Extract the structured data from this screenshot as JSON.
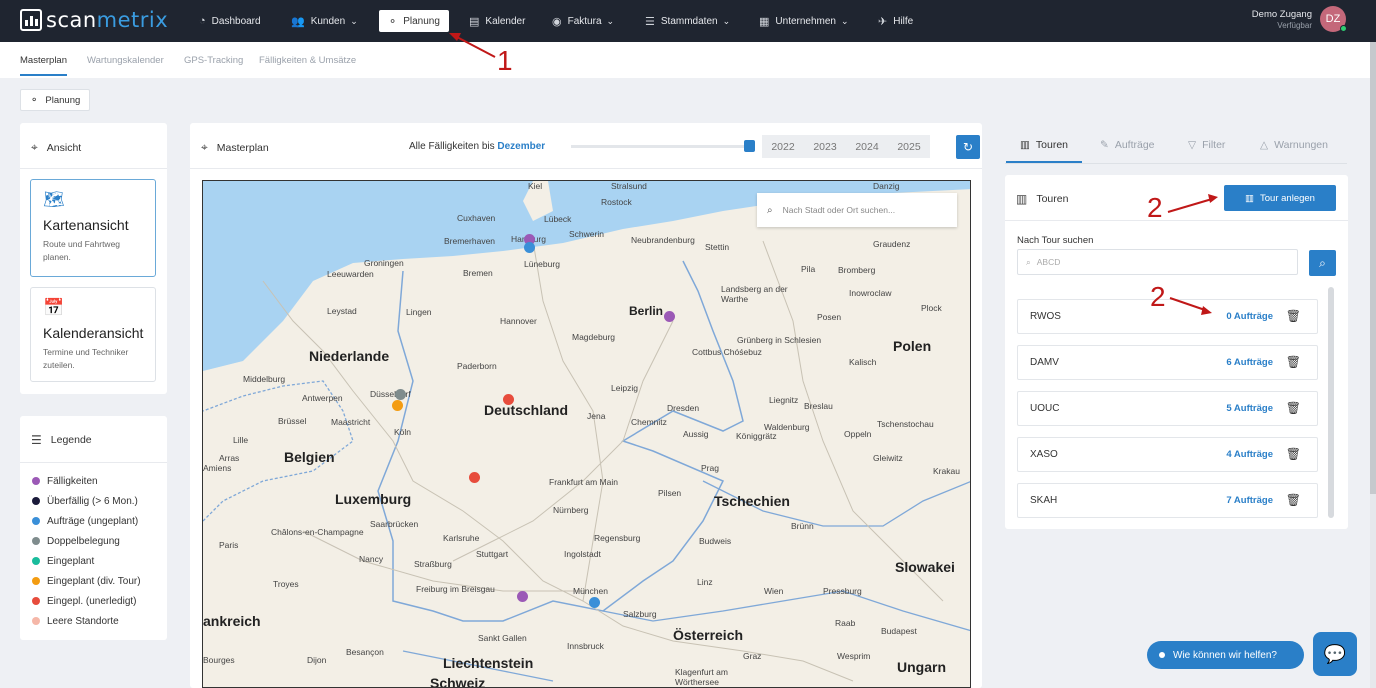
{
  "topnav": {
    "logo": {
      "part1": "scan",
      "part2": "metrix"
    },
    "items": [
      {
        "label": "Dashboard",
        "icon": "gauge-icon"
      },
      {
        "label": "Kunden",
        "icon": "users-icon"
      },
      {
        "label": "Planung",
        "icon": "hierarchy-icon"
      },
      {
        "label": "Kalender",
        "icon": "calendar-icon"
      },
      {
        "label": "Faktura",
        "icon": "coins-icon"
      },
      {
        "label": "Stammdaten",
        "icon": "database-icon"
      },
      {
        "label": "Unternehmen",
        "icon": "building-icon"
      },
      {
        "label": "Hilfe",
        "icon": "lifebuoy-icon"
      }
    ],
    "user": {
      "name": "Demo Zugang",
      "status": "Verfügbar",
      "initials": "DZ"
    }
  },
  "subnav": {
    "tabs": [
      "Masterplan",
      "Wartungskalender",
      "GPS-Tracking",
      "Fälligkeiten & Umsätze"
    ]
  },
  "chip": {
    "label": "Planung"
  },
  "ansicht": {
    "title": "Ansicht",
    "options": [
      {
        "title": "Kartenansicht",
        "desc": "Route und Fahrtweg planen."
      },
      {
        "title": "Kalenderansicht",
        "desc": "Termine und Techniker zuteilen."
      }
    ]
  },
  "legend": {
    "title": "Legende",
    "items": [
      {
        "label": "Fälligkeiten",
        "color": "#9b59b6"
      },
      {
        "label": "Überfällig (> 6 Mon.)",
        "color": "#1a1a3a"
      },
      {
        "label": "Aufträge (ungeplant)",
        "color": "#3a8fd8"
      },
      {
        "label": "Doppelbelegung",
        "color": "#7f8c8d"
      },
      {
        "label": "Eingeplant",
        "color": "#1abc9c"
      },
      {
        "label": "Eingeplant (div. Tour)",
        "color": "#f39c12"
      },
      {
        "label": "Eingepl. (unerledigt)",
        "color": "#e74c3c"
      },
      {
        "label": "Leere Standorte",
        "color": "#f5b7a8"
      }
    ]
  },
  "masterplan": {
    "title": "Masterplan",
    "due_label": "Alle Fälligkeiten bis",
    "due_month": "Dezember",
    "years": [
      "2022",
      "2023",
      "2024",
      "2025"
    ],
    "selected_year": "2022",
    "slider_level": 1.0,
    "map_search_placeholder": "Nach Stadt oder Ort suchen...",
    "map_labels": {
      "countries": [
        "Niederlande",
        "Deutschland",
        "Polen",
        "Belgien",
        "Tschechien",
        "Slowakei",
        "Österreich",
        "Ungarn",
        "ankreich",
        "Schweiz",
        "Liechtenstein",
        "Luxemburg"
      ],
      "cities": [
        "Kiel",
        "Stralsund",
        "Danzig",
        "Rostock",
        "Cuxhaven",
        "Lübeck",
        "Bremerhaven",
        "Hamburg",
        "Schwerin",
        "Neubrandenburg",
        "Stettin",
        "Graudenz",
        "Groningen",
        "Bremen",
        "Lüneburg",
        "Pila",
        "Bromberg",
        "Inowroclaw",
        "Leeuwarden",
        "Leystad",
        "Lingen",
        "Hannover",
        "Berlin",
        "Landsberg an der Warthe",
        "Posen",
        "Plock",
        "Magdeburg",
        "Cottbus Chóśebuz",
        "Grünberg in Schlesien",
        "Kalisch",
        "Paderborn",
        "Middelburg",
        "Antwerpen",
        "Düsseldorf",
        "Leipzig",
        "Dresden",
        "Liegnitz",
        "Breslau",
        "Brüssel",
        "Maastricht",
        "Köln",
        "Jena",
        "Chemnitz",
        "Waldenburg",
        "Oppeln",
        "Tschenstochau",
        "Lille",
        "Aussig",
        "Königgrätz",
        "Gleiwitz",
        "Arras",
        "Krakau",
        "Frankfurt am Main",
        "Prag",
        "Pilsen",
        "Saarbrücken",
        "Nürnberg",
        "Brünn",
        "Châlons-en-Champagne",
        "Karlsruhe",
        "Regensburg",
        "Paris",
        "Nancy",
        "Stuttgart",
        "Ingolstadt",
        "Budweis",
        "Troyes",
        "Straßburg",
        "Linz",
        "Wien",
        "Pressburg",
        "Freiburg im Breisgau",
        "München",
        "Salzburg",
        "Raab",
        "Budapest",
        "Sankt Gallen",
        "Innsbruck",
        "Dijon",
        "Besançon",
        "Graz",
        "Wesprim",
        "Bourges",
        "Klagenfurt am Wörthersee",
        "Amiens"
      ]
    },
    "markers": [
      {
        "color": "#9b59b6"
      },
      {
        "color": "#3a8fd8"
      },
      {
        "color": "#9b59b6"
      },
      {
        "color": "#e74c3c"
      },
      {
        "color": "#7f8c8d"
      },
      {
        "color": "#f39c12"
      },
      {
        "color": "#e74c3c"
      },
      {
        "color": "#9b59b6"
      },
      {
        "color": "#3a8fd8"
      }
    ]
  },
  "right": {
    "tabs": [
      {
        "label": "Touren",
        "icon": "map-icon"
      },
      {
        "label": "Aufträge",
        "icon": "wrench-icon"
      },
      {
        "label": "Filter",
        "icon": "filter-icon"
      },
      {
        "label": "Warnungen",
        "icon": "warning-icon"
      }
    ],
    "touren_title": "Touren",
    "add_button": "Tour anlegen",
    "search_label": "Nach Tour suchen",
    "search_placeholder": "ABCD",
    "tours": [
      {
        "name": "RWOS",
        "orders": "0 Aufträge"
      },
      {
        "name": "DAMV",
        "orders": "6 Aufträge"
      },
      {
        "name": "UOUC",
        "orders": "5 Aufträge"
      },
      {
        "name": "XASO",
        "orders": "4 Aufträge"
      },
      {
        "name": "SKAH",
        "orders": "7 Aufträge"
      }
    ]
  },
  "annotations": {
    "one": "1",
    "two_a": "2",
    "two_b": "2"
  },
  "help": {
    "label": "Wie können wir helfen?"
  }
}
